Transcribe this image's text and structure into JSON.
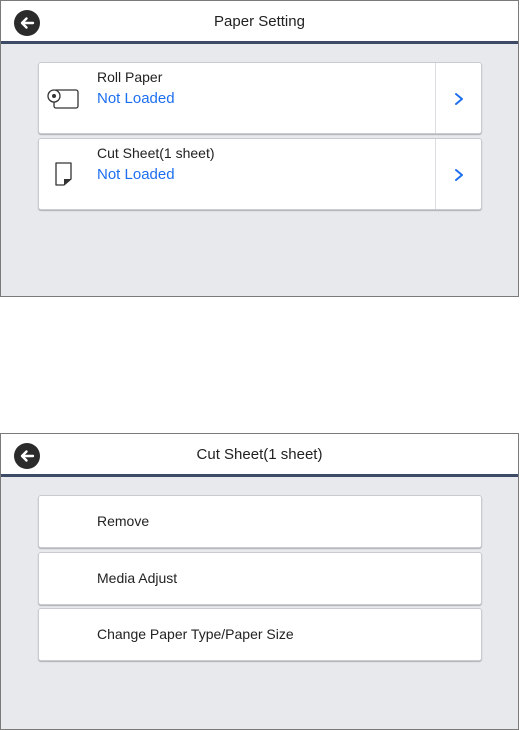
{
  "screen1": {
    "title": "Paper Setting",
    "items": [
      {
        "label": "Roll Paper",
        "status": "Not Loaded",
        "icon": "roll-paper-icon"
      },
      {
        "label": "Cut Sheet(1 sheet)",
        "status": "Not Loaded",
        "icon": "cut-sheet-icon"
      }
    ]
  },
  "screen2": {
    "title": "Cut Sheet(1 sheet)",
    "items": [
      {
        "label": "Remove"
      },
      {
        "label": "Media Adjust"
      },
      {
        "label": "Change Paper Type/Paper Size"
      }
    ]
  },
  "colors": {
    "background": "#e8e9ed",
    "header_rule": "#3d4a66",
    "status_text": "#1e6ff0",
    "back_button": "#2b2b2b"
  }
}
